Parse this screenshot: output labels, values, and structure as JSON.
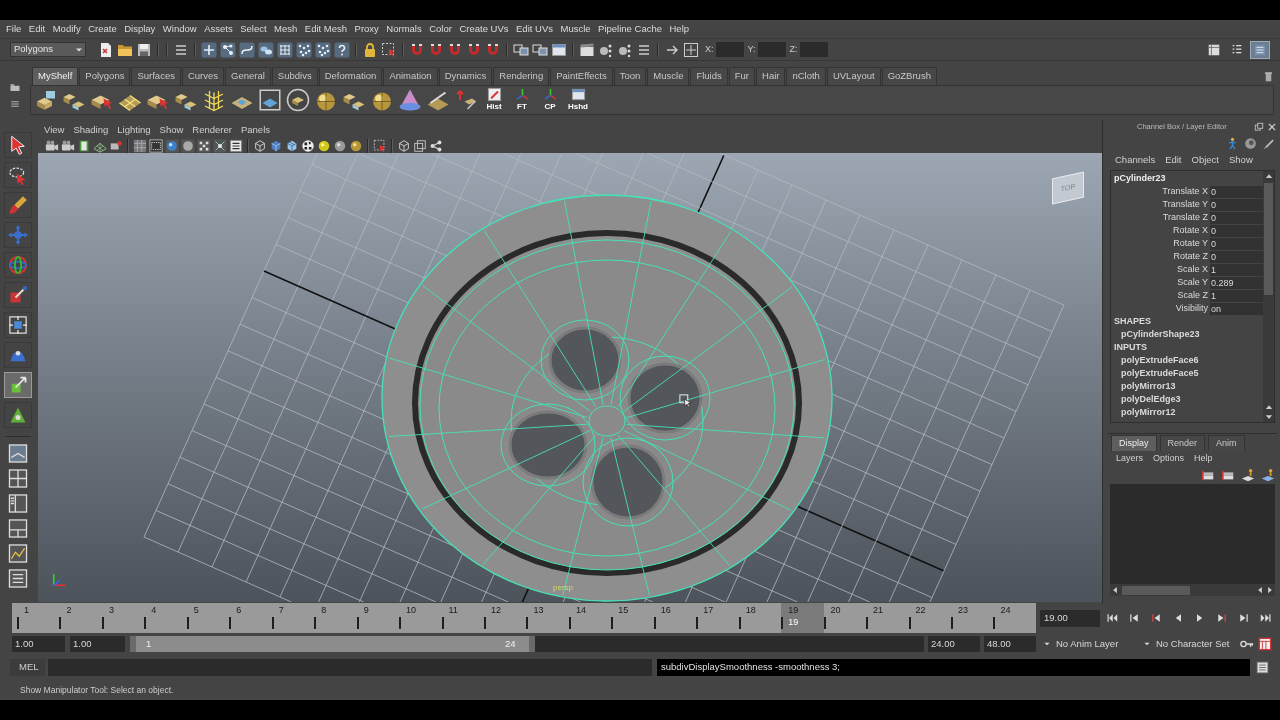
{
  "menu_bar": {
    "items": [
      "File",
      "Edit",
      "Modify",
      "Create",
      "Display",
      "Window",
      "Assets",
      "Select",
      "Mesh",
      "Edit Mesh",
      "Proxy",
      "Normals",
      "Color",
      "Create UVs",
      "Edit UVs",
      "Muscle",
      "Pipeline Cache",
      "Help"
    ]
  },
  "status_line": {
    "menu_set": "Polygons",
    "fields": [
      {
        "label": "X:"
      },
      {
        "label": "Y:"
      },
      {
        "label": "Z:"
      }
    ],
    "panel_toggles": [
      {
        "on": false
      },
      {
        "on": false
      },
      {
        "on": true
      }
    ]
  },
  "shelf": {
    "tabs": [
      {
        "label": "MyShelf",
        "selected": true
      },
      {
        "label": "Polygons",
        "selected": false
      },
      {
        "label": "Surfaces",
        "selected": false
      },
      {
        "label": "Curves",
        "selected": false
      },
      {
        "label": "General",
        "selected": false
      },
      {
        "label": "Subdivs",
        "selected": false
      },
      {
        "label": "Deformation",
        "selected": false
      },
      {
        "label": "Animation",
        "selected": false
      },
      {
        "label": "Dynamics",
        "selected": false
      },
      {
        "label": "Rendering",
        "selected": false
      },
      {
        "label": "PaintEffects",
        "selected": false
      },
      {
        "label": "Toon",
        "selected": false
      },
      {
        "label": "Muscle",
        "selected": false
      },
      {
        "label": "Fluids",
        "selected": false
      },
      {
        "label": "Fur",
        "selected": false
      },
      {
        "label": "Hair",
        "selected": false
      },
      {
        "label": "nCloth",
        "selected": false
      },
      {
        "label": "UVLayout",
        "selected": false
      },
      {
        "label": "GoZBrush",
        "selected": false
      }
    ],
    "buttons": [
      {
        "label": "Hist"
      },
      {
        "label": "FT"
      },
      {
        "label": "CP"
      },
      {
        "label": "Hshd"
      }
    ]
  },
  "toolbox": {
    "tools": [
      {
        "selected": false
      },
      {
        "selected": false
      },
      {
        "selected": false
      },
      {
        "selected": false
      },
      {
        "selected": false
      },
      {
        "selected": false
      },
      {
        "selected": false
      },
      {
        "selected": false
      },
      {
        "selected": true
      },
      {
        "selected": false
      }
    ]
  },
  "viewport": {
    "menu": [
      "View",
      "Shading",
      "Lighting",
      "Show",
      "Renderer",
      "Panels"
    ],
    "view_cube": "TOP",
    "camera": "persp"
  },
  "channel_box": {
    "title": "Channel Box / Layer Editor",
    "menu": [
      "Channels",
      "Edit",
      "Object",
      "Show"
    ],
    "object": "pCylinder23",
    "attributes": [
      {
        "name": "Translate X",
        "value": "0"
      },
      {
        "name": "Translate Y",
        "value": "0"
      },
      {
        "name": "Translate Z",
        "value": "0"
      },
      {
        "name": "Rotate X",
        "value": "0"
      },
      {
        "name": "Rotate Y",
        "value": "0"
      },
      {
        "name": "Rotate Z",
        "value": "0"
      },
      {
        "name": "Scale X",
        "value": "1"
      },
      {
        "name": "Scale Y",
        "value": "0.289"
      },
      {
        "name": "Scale Z",
        "value": "1"
      },
      {
        "name": "Visibility",
        "value": "on"
      }
    ],
    "shapes_heading": "SHAPES",
    "shapes": [
      "pCylinderShape23"
    ],
    "inputs_heading": "INPUTS",
    "inputs": [
      "polyExtrudeFace6",
      "polyExtrudeFace5",
      "polyMirror13",
      "polyDelEdge3",
      "polyMirror12"
    ]
  },
  "layer_editor": {
    "tabs": [
      {
        "label": "Display",
        "selected": true
      },
      {
        "label": "Render",
        "selected": false
      },
      {
        "label": "Anim",
        "selected": false
      }
    ],
    "menu": [
      "Layers",
      "Options",
      "Help"
    ]
  },
  "time_slider": {
    "frames": [
      {
        "label": "1",
        "selected": false
      },
      {
        "label": "2",
        "selected": false
      },
      {
        "label": "3",
        "selected": false
      },
      {
        "label": "4",
        "selected": false
      },
      {
        "label": "5",
        "selected": false
      },
      {
        "label": "6",
        "selected": false
      },
      {
        "label": "7",
        "selected": false
      },
      {
        "label": "8",
        "selected": false
      },
      {
        "label": "9",
        "selected": false
      },
      {
        "label": "10",
        "selected": false
      },
      {
        "label": "11",
        "selected": false
      },
      {
        "label": "12",
        "selected": false
      },
      {
        "label": "13",
        "selected": false
      },
      {
        "label": "14",
        "selected": false
      },
      {
        "label": "15",
        "selected": false
      },
      {
        "label": "16",
        "selected": false
      },
      {
        "label": "17",
        "selected": false
      },
      {
        "label": "18",
        "selected": false
      },
      {
        "label": "19",
        "selected": true
      },
      {
        "label": "20",
        "selected": false
      },
      {
        "label": "21",
        "selected": false
      },
      {
        "label": "22",
        "selected": false
      },
      {
        "label": "23",
        "selected": false
      },
      {
        "label": "24",
        "selected": false
      }
    ],
    "current_frame": "19",
    "current_time": "19.00"
  },
  "range_slider": {
    "start": "1.00",
    "range_start": "1.00",
    "handle_start": "1",
    "handle_end": "24",
    "level": 0.51,
    "range_end": "24.00",
    "end": "48.00",
    "anim_layer": "No Anim Layer",
    "character_set": "No Character Set"
  },
  "command_line": {
    "language": "MEL",
    "result": "subdivDisplaySmoothness -smoothness 3;"
  },
  "help_line": "Show Manipulator Tool: Select an object."
}
